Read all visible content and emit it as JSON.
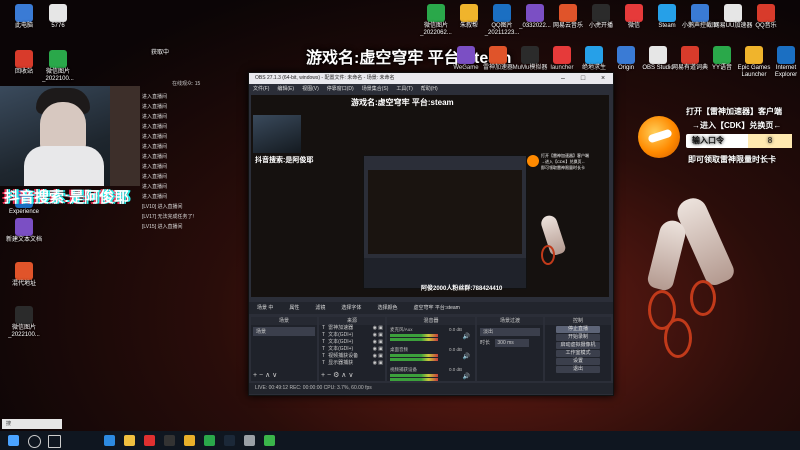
{
  "stream": {
    "title": "游戏名:虚空穹牢 平台:steam",
    "douyin_search": "抖音搜索:是阿俊耶",
    "fans_group": "阿俊2000人粉丝群:788424410",
    "viewers_label": "在线观众: 15"
  },
  "desktop_left": [
    {
      "label": "此电脑"
    },
    {
      "label": "5776"
    },
    {
      "label": "回收站"
    },
    {
      "label": "微信图片_2022100..."
    },
    {
      "label": "获取中"
    },
    {
      "label": "Experience"
    },
    {
      "label": "新建文本文档"
    },
    {
      "label": "混代地址"
    },
    {
      "label": "微信图片_2022100..."
    }
  ],
  "desktop_top": [
    {
      "label": "微信图片_2022062..."
    },
    {
      "label": "朱叙帮"
    },
    {
      "label": "QQ图片_20211223..."
    },
    {
      "label": "_0332022..."
    },
    {
      "label": "网易云音乐"
    },
    {
      "label": "小虎开播"
    },
    {
      "label": "微信"
    },
    {
      "label": "Steam"
    },
    {
      "label": "小鹅声控截图"
    },
    {
      "label": "网易UU加速器"
    },
    {
      "label": "QQ音乐"
    }
  ],
  "desktop_row2": [
    {
      "label": "WeGame"
    },
    {
      "label": "雷神加速器"
    },
    {
      "label": "MuMu模拟器"
    },
    {
      "label": "launcher"
    },
    {
      "label": "绝地求生"
    },
    {
      "label": "Origin"
    },
    {
      "label": "OBS Studio"
    },
    {
      "label": "网易有道词典"
    },
    {
      "label": "YY语音"
    },
    {
      "label": "Epic Games Launcher"
    },
    {
      "label": "Internet Explorer"
    }
  ],
  "chat": [
    "进入直播间",
    "进入直播间",
    "进入直播间",
    "进入直播间",
    "进入直播间",
    "进入直播间",
    "进入直播间",
    "进入直播间",
    "进入直播间",
    "进入直播间",
    "进入直播间",
    "[LV10] 进入直播间",
    "[LV17] 无法完成任务了!",
    "[LV15] 进入直播间"
  ],
  "obs": {
    "window_title": "OBS 27.1.3 (64-bit, windows) - 配置文件: 未命名 - 场景: 未命名",
    "menu": [
      "文件(F)",
      "编辑(E)",
      "视图(V)",
      "停靠窗口(D)",
      "场景集合(S)",
      "工具(T)",
      "帮助(H)"
    ],
    "tabs": [
      "场景 中",
      "属性",
      "滤镜",
      "选择字体",
      "选择颜色",
      "虚空穹牢 平台:steam"
    ],
    "scenes_header": "场景",
    "scenes": [
      "场景"
    ],
    "sources_header": "来源",
    "sources": [
      "雷神加速器",
      "文本(GDI+)",
      "文本(GDI+)",
      "文本(GDI+)",
      "视频捕获设备",
      "显示器捕获"
    ],
    "mixer_header": "混音器",
    "mixer": [
      {
        "name": "麦克风/Aux",
        "db": "0.0 dB"
      },
      {
        "name": "桌面音频",
        "db": "0.0 dB"
      },
      {
        "name": "视频捕获设备",
        "db": "0.0 dB"
      }
    ],
    "transitions_header": "场景过渡",
    "transition_type": "淡出",
    "duration_label": "时长",
    "duration_value": "300 ms",
    "controls_header": "控制",
    "controls": [
      "停止直播",
      "开始录制",
      "启动虚拟摄像机",
      "工作室模式",
      "设置",
      "退出"
    ],
    "status": "LIVE: 00:49:12   REC: 00:00:00   CPU: 3.7%, 60.00 fps"
  },
  "ad": {
    "line1": "打开【雷神加速器】客户端",
    "line2": "→进入【CDK】兑换页←",
    "code_label": "输入口令",
    "code_value": "8",
    "line3": "即可领取雷神限量时长卡"
  },
  "taskbar": {
    "search_placeholder": "搜",
    "icons": [
      "windows-start-icon",
      "search-icon",
      "task-view-icon",
      "edge-icon",
      "folder-icon",
      "app-red-icon",
      "obs-icon",
      "chrome-icon",
      "wechat-icon",
      "steam-icon",
      "settings-icon",
      "app-green-icon"
    ]
  },
  "colors": {
    "accent_orange": "#ff8a00",
    "chain_red": "#c13a1a",
    "obs_bg": "#2b2e38"
  }
}
